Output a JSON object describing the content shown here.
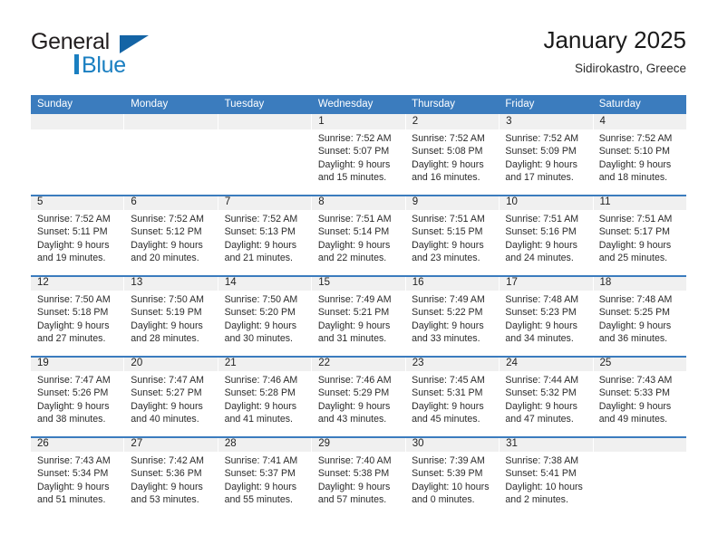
{
  "brand": {
    "name_part1": "General",
    "name_part2": "Blue",
    "logo_icon": "triangle-logo-icon"
  },
  "header": {
    "title": "January 2025",
    "location": "Sidirokastro, Greece"
  },
  "calendar": {
    "day_headers": [
      "Sunday",
      "Monday",
      "Tuesday",
      "Wednesday",
      "Thursday",
      "Friday",
      "Saturday"
    ],
    "colors": {
      "header_blue": "#3b7cbe",
      "number_band": "#f0f0f0",
      "brand_blue": "#1a7fc1",
      "logo_blue": "#1464a5",
      "text": "#2b2b2b"
    },
    "weeks": [
      {
        "days": [
          {
            "date": "",
            "lines": []
          },
          {
            "date": "",
            "lines": []
          },
          {
            "date": "",
            "lines": []
          },
          {
            "date": "1",
            "lines": [
              "Sunrise: 7:52 AM",
              "Sunset: 5:07 PM",
              "Daylight: 9 hours",
              "and 15 minutes."
            ]
          },
          {
            "date": "2",
            "lines": [
              "Sunrise: 7:52 AM",
              "Sunset: 5:08 PM",
              "Daylight: 9 hours",
              "and 16 minutes."
            ]
          },
          {
            "date": "3",
            "lines": [
              "Sunrise: 7:52 AM",
              "Sunset: 5:09 PM",
              "Daylight: 9 hours",
              "and 17 minutes."
            ]
          },
          {
            "date": "4",
            "lines": [
              "Sunrise: 7:52 AM",
              "Sunset: 5:10 PM",
              "Daylight: 9 hours",
              "and 18 minutes."
            ]
          }
        ]
      },
      {
        "days": [
          {
            "date": "5",
            "lines": [
              "Sunrise: 7:52 AM",
              "Sunset: 5:11 PM",
              "Daylight: 9 hours",
              "and 19 minutes."
            ]
          },
          {
            "date": "6",
            "lines": [
              "Sunrise: 7:52 AM",
              "Sunset: 5:12 PM",
              "Daylight: 9 hours",
              "and 20 minutes."
            ]
          },
          {
            "date": "7",
            "lines": [
              "Sunrise: 7:52 AM",
              "Sunset: 5:13 PM",
              "Daylight: 9 hours",
              "and 21 minutes."
            ]
          },
          {
            "date": "8",
            "lines": [
              "Sunrise: 7:51 AM",
              "Sunset: 5:14 PM",
              "Daylight: 9 hours",
              "and 22 minutes."
            ]
          },
          {
            "date": "9",
            "lines": [
              "Sunrise: 7:51 AM",
              "Sunset: 5:15 PM",
              "Daylight: 9 hours",
              "and 23 minutes."
            ]
          },
          {
            "date": "10",
            "lines": [
              "Sunrise: 7:51 AM",
              "Sunset: 5:16 PM",
              "Daylight: 9 hours",
              "and 24 minutes."
            ]
          },
          {
            "date": "11",
            "lines": [
              "Sunrise: 7:51 AM",
              "Sunset: 5:17 PM",
              "Daylight: 9 hours",
              "and 25 minutes."
            ]
          }
        ]
      },
      {
        "days": [
          {
            "date": "12",
            "lines": [
              "Sunrise: 7:50 AM",
              "Sunset: 5:18 PM",
              "Daylight: 9 hours",
              "and 27 minutes."
            ]
          },
          {
            "date": "13",
            "lines": [
              "Sunrise: 7:50 AM",
              "Sunset: 5:19 PM",
              "Daylight: 9 hours",
              "and 28 minutes."
            ]
          },
          {
            "date": "14",
            "lines": [
              "Sunrise: 7:50 AM",
              "Sunset: 5:20 PM",
              "Daylight: 9 hours",
              "and 30 minutes."
            ]
          },
          {
            "date": "15",
            "lines": [
              "Sunrise: 7:49 AM",
              "Sunset: 5:21 PM",
              "Daylight: 9 hours",
              "and 31 minutes."
            ]
          },
          {
            "date": "16",
            "lines": [
              "Sunrise: 7:49 AM",
              "Sunset: 5:22 PM",
              "Daylight: 9 hours",
              "and 33 minutes."
            ]
          },
          {
            "date": "17",
            "lines": [
              "Sunrise: 7:48 AM",
              "Sunset: 5:23 PM",
              "Daylight: 9 hours",
              "and 34 minutes."
            ]
          },
          {
            "date": "18",
            "lines": [
              "Sunrise: 7:48 AM",
              "Sunset: 5:25 PM",
              "Daylight: 9 hours",
              "and 36 minutes."
            ]
          }
        ]
      },
      {
        "days": [
          {
            "date": "19",
            "lines": [
              "Sunrise: 7:47 AM",
              "Sunset: 5:26 PM",
              "Daylight: 9 hours",
              "and 38 minutes."
            ]
          },
          {
            "date": "20",
            "lines": [
              "Sunrise: 7:47 AM",
              "Sunset: 5:27 PM",
              "Daylight: 9 hours",
              "and 40 minutes."
            ]
          },
          {
            "date": "21",
            "lines": [
              "Sunrise: 7:46 AM",
              "Sunset: 5:28 PM",
              "Daylight: 9 hours",
              "and 41 minutes."
            ]
          },
          {
            "date": "22",
            "lines": [
              "Sunrise: 7:46 AM",
              "Sunset: 5:29 PM",
              "Daylight: 9 hours",
              "and 43 minutes."
            ]
          },
          {
            "date": "23",
            "lines": [
              "Sunrise: 7:45 AM",
              "Sunset: 5:31 PM",
              "Daylight: 9 hours",
              "and 45 minutes."
            ]
          },
          {
            "date": "24",
            "lines": [
              "Sunrise: 7:44 AM",
              "Sunset: 5:32 PM",
              "Daylight: 9 hours",
              "and 47 minutes."
            ]
          },
          {
            "date": "25",
            "lines": [
              "Sunrise: 7:43 AM",
              "Sunset: 5:33 PM",
              "Daylight: 9 hours",
              "and 49 minutes."
            ]
          }
        ]
      },
      {
        "days": [
          {
            "date": "26",
            "lines": [
              "Sunrise: 7:43 AM",
              "Sunset: 5:34 PM",
              "Daylight: 9 hours",
              "and 51 minutes."
            ]
          },
          {
            "date": "27",
            "lines": [
              "Sunrise: 7:42 AM",
              "Sunset: 5:36 PM",
              "Daylight: 9 hours",
              "and 53 minutes."
            ]
          },
          {
            "date": "28",
            "lines": [
              "Sunrise: 7:41 AM",
              "Sunset: 5:37 PM",
              "Daylight: 9 hours",
              "and 55 minutes."
            ]
          },
          {
            "date": "29",
            "lines": [
              "Sunrise: 7:40 AM",
              "Sunset: 5:38 PM",
              "Daylight: 9 hours",
              "and 57 minutes."
            ]
          },
          {
            "date": "30",
            "lines": [
              "Sunrise: 7:39 AM",
              "Sunset: 5:39 PM",
              "Daylight: 10 hours",
              "and 0 minutes."
            ]
          },
          {
            "date": "31",
            "lines": [
              "Sunrise: 7:38 AM",
              "Sunset: 5:41 PM",
              "Daylight: 10 hours",
              "and 2 minutes."
            ]
          },
          {
            "date": "",
            "lines": []
          }
        ]
      }
    ]
  }
}
